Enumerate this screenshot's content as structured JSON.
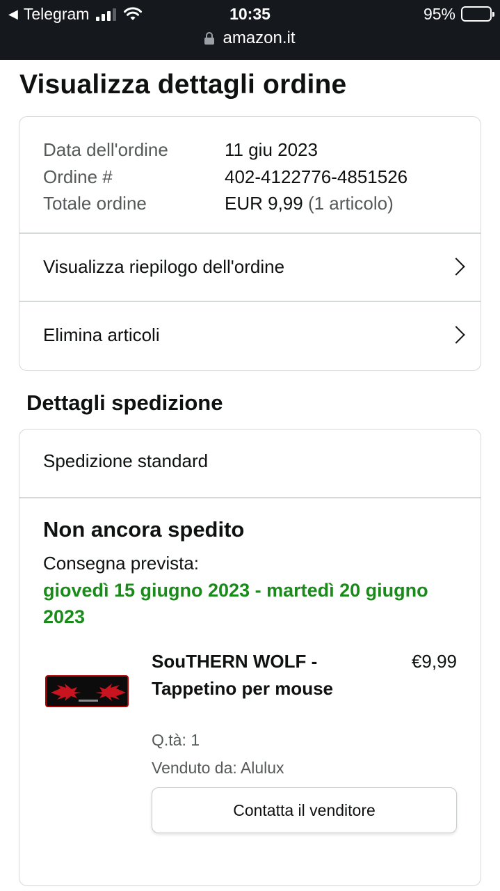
{
  "status_bar": {
    "back_app": "Telegram",
    "time": "10:35",
    "battery": "95%",
    "url": "amazon.it"
  },
  "page": {
    "title": "Visualizza dettagli ordine"
  },
  "order_summary": {
    "rows": [
      {
        "label": "Data dell'ordine",
        "value": "11 giu 2023",
        "extra": ""
      },
      {
        "label": "Ordine #",
        "value": "402-4122776-4851526",
        "extra": ""
      },
      {
        "label": "Totale ordine",
        "value": "EUR 9,99",
        "extra": "(1 articolo)"
      }
    ],
    "links": [
      {
        "label": "Visualizza riepilogo dell'ordine"
      },
      {
        "label": "Elimina articoli"
      }
    ]
  },
  "shipping": {
    "section_title": "Dettagli spedizione",
    "method": "Spedizione standard",
    "status": "Non ancora spedito",
    "delivery_label": "Consegna prevista:",
    "delivery_date": "giovedì 15 giugno 2023 - martedì 20 giugno 2023",
    "delivery_color": "#1a8a1a"
  },
  "product": {
    "title": "SouTHERN WOLF - Tappetino per mouse",
    "price": "€9,99",
    "qty": "Q.tà: 1",
    "seller": "Venduto da: Alulux",
    "contact_button": "Contatta il venditore"
  }
}
